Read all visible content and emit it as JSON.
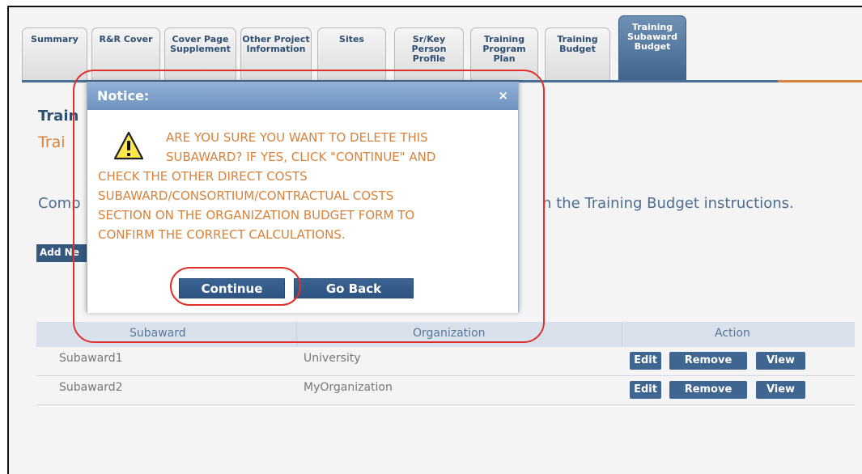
{
  "tabs": [
    {
      "label": "Summary",
      "active": false
    },
    {
      "label": "R&R Cover",
      "active": false
    },
    {
      "label": "Cover Page Supplement",
      "active": false
    },
    {
      "label": "Other Project Information",
      "active": false
    },
    {
      "label": "Sites",
      "active": false
    },
    {
      "label": "Sr/Key Person Profile",
      "active": false
    },
    {
      "label": "Training Program Plan",
      "active": false
    },
    {
      "label": "Training Budget",
      "active": false
    },
    {
      "label": "Training Subaward Budget",
      "active": true
    }
  ],
  "page": {
    "heading_partial": "Train",
    "subheading_partial": "Trai",
    "instructions_left_partial": "Comp",
    "instructions_right": "n the Training Budget instructions.",
    "add_button_partial": "Add Ne"
  },
  "table": {
    "headers": [
      "Subaward",
      "Organization",
      "Action"
    ],
    "rows": [
      {
        "subaward": "Subaward1",
        "organization": "University"
      },
      {
        "subaward": "Subaward2",
        "organization": "MyOrganization"
      }
    ],
    "actions": [
      "Edit",
      "Remove",
      "View"
    ]
  },
  "dialog": {
    "title": "Notice:",
    "close_glyph": "×",
    "message_lines": [
      "ARE YOU SURE YOU WANT TO DELETE THIS",
      "SUBAWARD? IF YES, CLICK \"CONTINUE\" AND",
      "CHECK THE OTHER DIRECT COSTS",
      "SUBAWARD/CONSORTIUM/CONTRACTUAL COSTS",
      "SECTION ON THE ORGANIZATION BUDGET FORM TO",
      "CONFIRM THE CORRECT CALCULATIONS."
    ],
    "continue_label": "Continue",
    "go_back_label": "Go Back",
    "icon": "warning-icon"
  },
  "colors": {
    "accent_orange": "#d9823b",
    "nav_blue": "#34587e",
    "highlight_red": "#e0302c"
  }
}
